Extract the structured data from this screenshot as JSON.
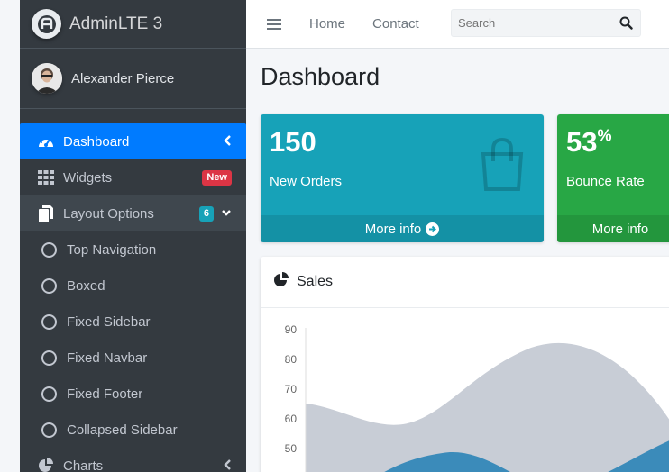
{
  "brand": {
    "name": "AdminLTE 3",
    "logo_icon": "adminlte-logo-icon"
  },
  "user": {
    "name": "Alexander Pierce"
  },
  "sidebar": {
    "items": [
      {
        "label": "Dashboard",
        "icon": "tachometer-icon"
      },
      {
        "label": "Widgets",
        "icon": "grid-icon",
        "badge": "New"
      },
      {
        "label": "Layout Options",
        "icon": "copy-icon",
        "badge": "6"
      },
      {
        "label": "Charts",
        "icon": "pie-chart-icon"
      }
    ],
    "sub_items": [
      {
        "label": "Top Navigation"
      },
      {
        "label": "Boxed"
      },
      {
        "label": "Fixed Sidebar"
      },
      {
        "label": "Fixed Navbar"
      },
      {
        "label": "Fixed Footer"
      },
      {
        "label": "Collapsed Sidebar"
      }
    ]
  },
  "navbar": {
    "home": "Home",
    "contact": "Contact",
    "search_placeholder": "Search"
  },
  "content": {
    "title": "Dashboard",
    "boxes": [
      {
        "value": "150",
        "label": "New Orders",
        "footer": "More info",
        "color": "#17a2b8",
        "icon": "shopping-bag-icon"
      },
      {
        "value": "53",
        "suffix": "%",
        "label": "Bounce Rate",
        "footer": "More info",
        "color": "#28a745"
      }
    ],
    "card": {
      "title": "Sales",
      "icon": "pie-chart-icon"
    }
  },
  "chart_data": {
    "type": "area",
    "y_ticks": [
      "90",
      "80",
      "70",
      "60",
      "50"
    ],
    "ylim": [
      40,
      90
    ],
    "series": [
      {
        "color": "#c8cdd6"
      },
      {
        "color": "#3b8bba"
      }
    ]
  },
  "colors": {
    "sidebar_bg": "#343a40",
    "active": "#007bff",
    "info": "#17a2b8",
    "success": "#28a745",
    "danger": "#dc3545"
  }
}
